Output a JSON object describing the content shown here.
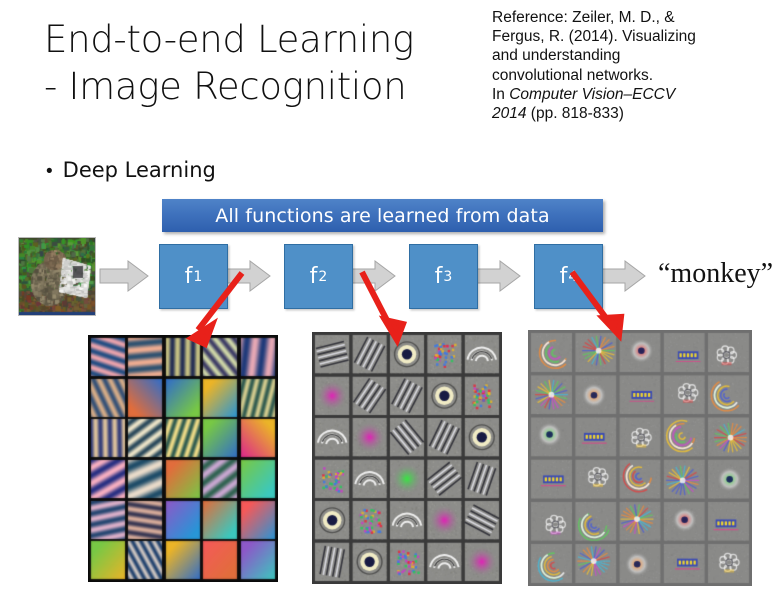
{
  "slide": {
    "title": "End-to-end Learning\n- Image Recognition",
    "bullet": {
      "marker": "•",
      "text": "Deep Learning"
    },
    "banner_text": "All functions are learned from data",
    "output_label": "“monkey”"
  },
  "reference": {
    "line1": "Reference: Zeiler, M. D., &",
    "line2": "Fergus, R. (2014). Visualizing",
    "line3": "and understanding",
    "line4": "convolutional networks.",
    "line5_prefix": "In ",
    "line5_italic": "Computer Vision–ECCV",
    "line6_italic": "2014",
    "line6_suffix": " (pp. 818-833)"
  },
  "pipeline": {
    "input_image_alt": "monkey-photo",
    "stages": [
      {
        "label": "f",
        "subscript": "1"
      },
      {
        "label": "f",
        "subscript": "2"
      },
      {
        "label": "f",
        "subscript": "3"
      },
      {
        "label": "f",
        "subscript": "4"
      }
    ],
    "arrow_count": 5
  },
  "feature_grids": [
    {
      "name": "layer-1-features",
      "columns": 5,
      "rows": 6,
      "style": "gabor-color-blobs"
    },
    {
      "name": "layer-2-features",
      "columns": 5,
      "rows": 6,
      "style": "texture-parts"
    },
    {
      "name": "layer-3-features",
      "columns": 5,
      "rows": 6,
      "style": "object-parts"
    }
  ],
  "red_arrows": [
    {
      "name": "arrow-f1-to-grid1",
      "from_stage": 1,
      "to_grid": 1
    },
    {
      "name": "arrow-f2-to-grid2",
      "from_stage": 2,
      "to_grid": 2
    },
    {
      "name": "arrow-f3-to-grid3",
      "from_stage": 3,
      "to_grid": 3
    }
  ],
  "colors": {
    "box_blue": "#4f90c8",
    "box_border": "#2f6ea3",
    "banner_blue_top": "#4f83c8",
    "banner_blue_bottom": "#2e5fae",
    "arrow_gray": "#d2d2d2",
    "arrow_gray_border": "#a6a6a6",
    "red": "#e8211a",
    "text_dark": "#111111"
  }
}
